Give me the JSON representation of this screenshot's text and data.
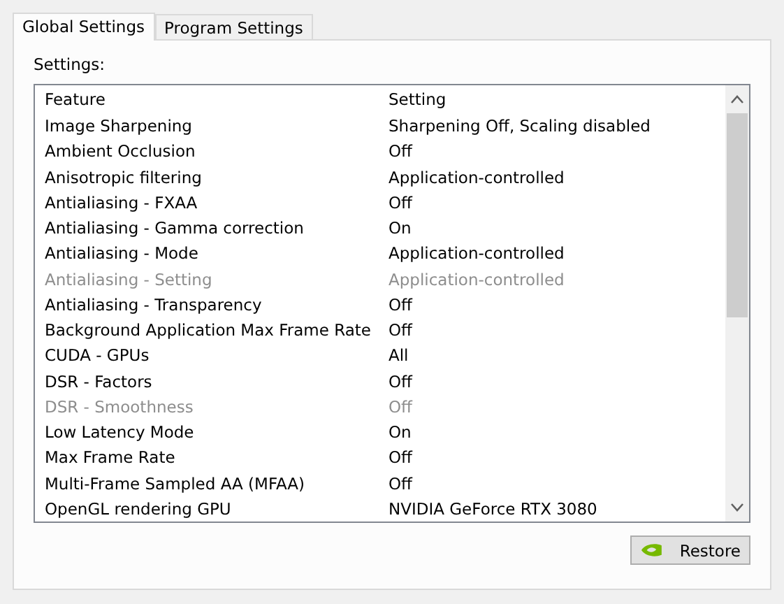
{
  "tabs": [
    {
      "label": "Global Settings",
      "selected": true
    },
    {
      "label": "Program Settings",
      "selected": false
    }
  ],
  "settings_label": "Settings:",
  "table": {
    "columns": [
      "Feature",
      "Setting"
    ],
    "rows": [
      {
        "feature": "Image Sharpening",
        "setting": "Sharpening Off, Scaling disabled",
        "disabled": false
      },
      {
        "feature": "Ambient Occlusion",
        "setting": "Off",
        "disabled": false
      },
      {
        "feature": "Anisotropic filtering",
        "setting": "Application-controlled",
        "disabled": false
      },
      {
        "feature": "Antialiasing - FXAA",
        "setting": "Off",
        "disabled": false
      },
      {
        "feature": "Antialiasing - Gamma correction",
        "setting": "On",
        "disabled": false
      },
      {
        "feature": "Antialiasing - Mode",
        "setting": "Application-controlled",
        "disabled": false
      },
      {
        "feature": "Antialiasing - Setting",
        "setting": "Application-controlled",
        "disabled": true
      },
      {
        "feature": "Antialiasing - Transparency",
        "setting": "Off",
        "disabled": false
      },
      {
        "feature": "Background Application Max Frame Rate",
        "setting": "Off",
        "disabled": false
      },
      {
        "feature": "CUDA - GPUs",
        "setting": "All",
        "disabled": false
      },
      {
        "feature": "DSR - Factors",
        "setting": "Off",
        "disabled": false
      },
      {
        "feature": "DSR - Smoothness",
        "setting": "Off",
        "disabled": true
      },
      {
        "feature": "Low Latency Mode",
        "setting": "On",
        "disabled": false
      },
      {
        "feature": "Max Frame Rate",
        "setting": "Off",
        "disabled": false
      },
      {
        "feature": "Multi-Frame Sampled AA (MFAA)",
        "setting": "Off",
        "disabled": false
      },
      {
        "feature": "OpenGL rendering GPU",
        "setting": "NVIDIA GeForce RTX 3080",
        "disabled": false
      }
    ]
  },
  "restore_button": "Restore"
}
